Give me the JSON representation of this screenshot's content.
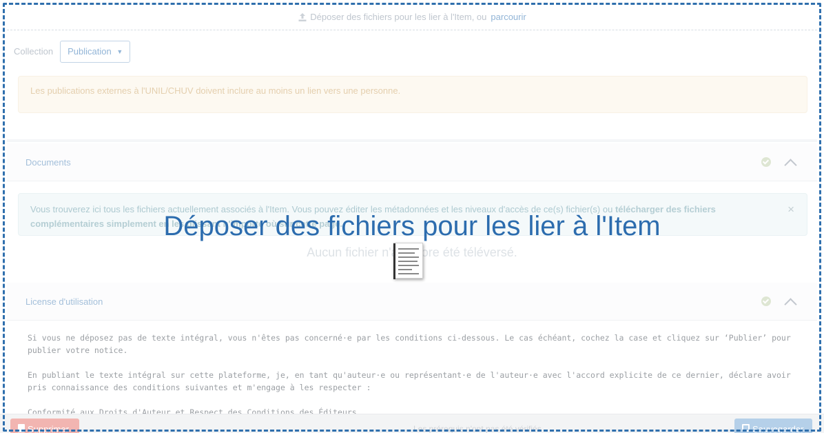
{
  "upload_bar": {
    "text": "Déposer des fichiers pour les lier à l'Item, ou",
    "browse_label": "parcourir"
  },
  "tabs": {
    "collection": "Collection",
    "publication": "Publication"
  },
  "warning": {
    "text": "Les publications externes à l'UNIL/CHUV doivent inclure au moins un lien vers une personne."
  },
  "documents_panel": {
    "title": "Documents",
    "info_text": "Vous trouverez ici tous les fichiers actuellement associés à l'Item. Vous pouvez éditer les métadonnées et les niveaux d'accès de ce(s) fichier(s) ou",
    "info_bold": "télécharger des fichiers complémentaires simplement en les glissant n'importe où sur cette page.",
    "close_label": "×",
    "no_file": "Aucun fichier n'a encore été téléversé."
  },
  "license_panel": {
    "title": "License d'utilisation",
    "paragraphs": [
      "Si vous ne déposez pas de texte intégral, vous n'êtes pas concerné·e par les conditions ci-dessous. Le cas échéant, cochez la case et cliquez sur ‘Publier’ pour publier votre notice.",
      "En publiant le texte intégral sur cette plateforme, je, en tant qu'auteur·e ou représentant·e de l'auteur·e avec l'accord explicite de ce dernier, déclare avoir pris connaissance des conditions suivantes et m'engage à les respecter :",
      "Conformité aux Droits d'Auteur et Respect des Conditions des Éditeurs"
    ]
  },
  "footer": {
    "delete_label": "Supprimer",
    "middle_text": "Les prérequis n'ont pas été vérifiés",
    "save_label": "Sauvegarder"
  },
  "overlay": {
    "title": "Déposer des fichiers pour les lier à l'Item"
  },
  "colors": {
    "accent": "#2c6cae",
    "link": "#7fa8d0",
    "danger": "#f0a8a4"
  }
}
